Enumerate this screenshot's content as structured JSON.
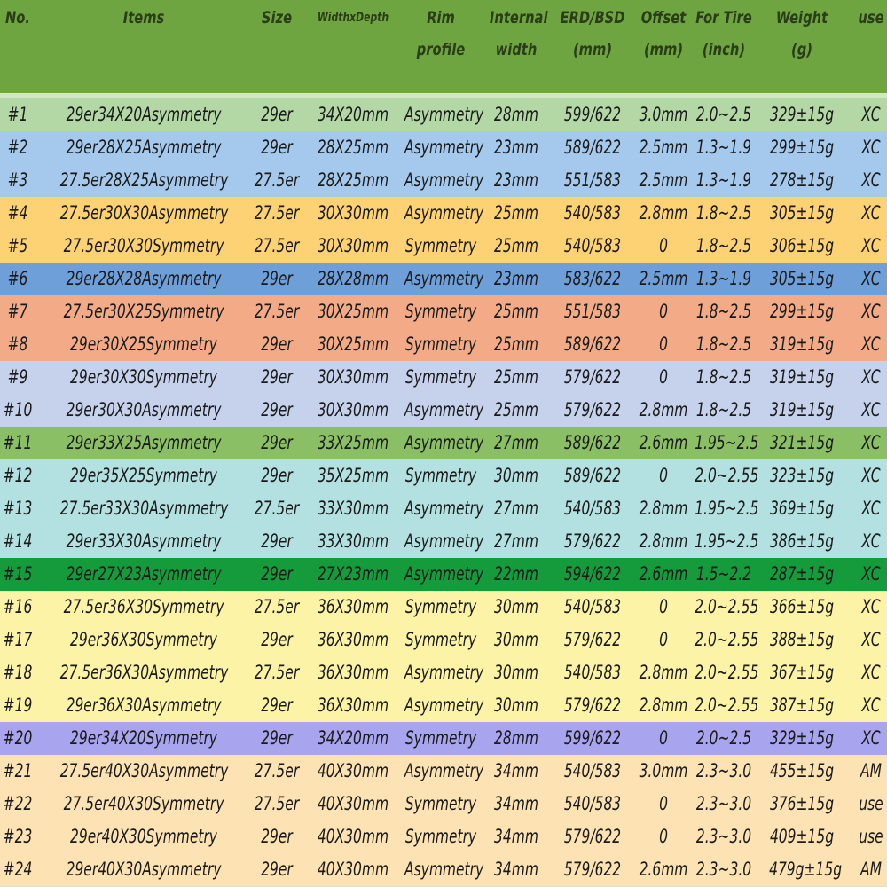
{
  "table": {
    "headers": [
      {
        "key": "no",
        "label": "No."
      },
      {
        "key": "items",
        "label": "Items"
      },
      {
        "key": "size",
        "label": "Size"
      },
      {
        "key": "wd",
        "label": "WidthxDepth"
      },
      {
        "key": "profile",
        "label": "Rim profile"
      },
      {
        "key": "internal",
        "label": "Internal\nwidth"
      },
      {
        "key": "erd",
        "label": "ERD/BSD\n(mm)"
      },
      {
        "key": "offset",
        "label": "Offset\n(mm)"
      },
      {
        "key": "tire",
        "label": "For Tire\n(inch)"
      },
      {
        "key": "weight",
        "label": "Weight\n(g)"
      },
      {
        "key": "use",
        "label": "use"
      }
    ],
    "rows": [
      {
        "cells": [
          "#1",
          "29er34X20Asymmetry",
          "29er",
          "34X20mm",
          "Asymmetry",
          "28mm",
          "599/622",
          "3.0mm",
          "2.0~2.5",
          "329±15g",
          "XC"
        ],
        "bg": "#b3d8a6"
      },
      {
        "cells": [
          "#2",
          "29er28X25Asymmetry",
          "29er",
          "28X25mm",
          "Asymmetry",
          "23mm",
          "589/622",
          "2.5mm",
          "1.3~1.9",
          "299±15g",
          "XC"
        ],
        "bg": "#a4c9ec"
      },
      {
        "cells": [
          "#3",
          "27.5er28X25Asymmetry",
          "27.5er",
          "28X25mm",
          "Asymmetry",
          "23mm",
          "551/583",
          "2.5mm",
          "1.3~1.9",
          "278±15g",
          "XC"
        ],
        "bg": "#a4c9ec"
      },
      {
        "cells": [
          "#4",
          "27.5er30X30Asymmetry",
          "27.5er",
          "30X30mm",
          "Asymmetry",
          "25mm",
          "540/583",
          "2.8mm",
          "1.8~2.5",
          "305±15g",
          "XC"
        ],
        "bg": "#fdd275"
      },
      {
        "cells": [
          "#5",
          "27.5er30X30Symmetry",
          "27.5er",
          "30X30mm",
          "Symmetry",
          "25mm",
          "540/583",
          "0",
          "1.8~2.5",
          "306±15g",
          "XC"
        ],
        "bg": "#fdd275"
      },
      {
        "cells": [
          "#6",
          "29er28X28Asymmetry",
          "29er",
          "28X28mm",
          "Asymmetry",
          "23mm",
          "583/622",
          "2.5mm",
          "1.3~1.9",
          "305±15g",
          "XC"
        ],
        "bg": "#6f9fd9"
      },
      {
        "cells": [
          "#7",
          "27.5er30X25Symmetry",
          "27.5er",
          "30X25mm",
          "Symmetry",
          "25mm",
          "551/583",
          "0",
          "1.8~2.5",
          "299±15g",
          "XC"
        ],
        "bg": "#f2ab86"
      },
      {
        "cells": [
          "#8",
          "29er30X25Symmetry",
          "29er",
          "30X25mm",
          "Symmetry",
          "25mm",
          "589/622",
          "0",
          "1.8~2.5",
          "319±15g",
          "XC"
        ],
        "bg": "#f2ab86"
      },
      {
        "cells": [
          "#9",
          "29er30X30Symmetry",
          "29er",
          "30X30mm",
          "Symmetry",
          "25mm",
          "579/622",
          "0",
          "1.8~2.5",
          "319±15g",
          "XC"
        ],
        "bg": "#c6d2ec"
      },
      {
        "cells": [
          "#10",
          "29er30X30Asymmetry",
          "29er",
          "30X30mm",
          "Asymmetry",
          "25mm",
          "579/622",
          "2.8mm",
          "1.8~2.5",
          "319±15g",
          "XC"
        ],
        "bg": "#c6d2ec"
      },
      {
        "cells": [
          "#11",
          "29er33X25Asymmetry",
          "29er",
          "33X25mm",
          "Asymmetry",
          "27mm",
          "589/622",
          "2.6mm",
          "1.95~2.5",
          "321±15g",
          "XC"
        ],
        "bg": "#8abf65"
      },
      {
        "cells": [
          "#12",
          "29er35X25Symmetry",
          "29er",
          "35X25mm",
          "Symmetry",
          "30mm",
          "589/622",
          "0",
          "2.0~2.55",
          "323±15g",
          "XC"
        ],
        "bg": "#b3e0e0"
      },
      {
        "cells": [
          "#13",
          "27.5er33X30Asymmetry",
          "27.5er",
          "33X30mm",
          "Asymmetry",
          "27mm",
          "540/583",
          "2.8mm",
          "1.95~2.5",
          "369±15g",
          "XC"
        ],
        "bg": "#b3e0e0"
      },
      {
        "cells": [
          "#14",
          "29er33X30Asymmetry",
          "29er",
          "33X30mm",
          "Asymmetry",
          "27mm",
          "579/622",
          "2.8mm",
          "1.95~2.5",
          "386±15g",
          "XC"
        ],
        "bg": "#b3e0e0"
      },
      {
        "cells": [
          "#15",
          "29er27X23Asymmetry",
          "29er",
          "27X23mm",
          "Asymmetry",
          "22mm",
          "594/622",
          "2.6mm",
          "1.5~2.2",
          "287±15g",
          "XC"
        ],
        "bg": "#159a3c"
      },
      {
        "cells": [
          "#16",
          "27.5er36X30Symmetry",
          "27.5er",
          "36X30mm",
          "Symmetry",
          "30mm",
          "540/583",
          "0",
          "2.0~2.55",
          "366±15g",
          "XC"
        ],
        "bg": "#fcf3a6"
      },
      {
        "cells": [
          "#17",
          "29er36X30Symmetry",
          "29er",
          "36X30mm",
          "Symmetry",
          "30mm",
          "579/622",
          "0",
          "2.0~2.55",
          "388±15g",
          "XC"
        ],
        "bg": "#fcf3a6"
      },
      {
        "cells": [
          "#18",
          "27.5er36X30Asymmetry",
          "27.5er",
          "36X30mm",
          "Asymmetry",
          "30mm",
          "540/583",
          "2.8mm",
          "2.0~2.55",
          "367±15g",
          "XC"
        ],
        "bg": "#fcf3a6"
      },
      {
        "cells": [
          "#19",
          "29er36X30Asymmetry",
          "29er",
          "36X30mm",
          "Asymmetry",
          "30mm",
          "579/622",
          "2.8mm",
          "2.0~2.55",
          "387±15g",
          "XC"
        ],
        "bg": "#fcf3a6"
      },
      {
        "cells": [
          "#20",
          "29er34X20Symmetry",
          "29er",
          "34X20mm",
          "Symmetry",
          "28mm",
          "599/622",
          "0",
          "2.0~2.5",
          "329±15g",
          "XC"
        ],
        "bg": "#a8a4ee"
      },
      {
        "cells": [
          "#21",
          "27.5er40X30Asymmetry",
          "27.5er",
          "40X30mm",
          "Asymmetry",
          "34mm",
          "540/583",
          "3.0mm",
          "2.3~3.0",
          "455±15g",
          "AM"
        ],
        "bg": "#fde3b3"
      },
      {
        "cells": [
          "#22",
          "27.5er40X30Symmetry",
          "27.5er",
          "40X30mm",
          "Symmetry",
          "34mm",
          "540/583",
          "0",
          "2.3~3.0",
          "376±15g",
          "use"
        ],
        "bg": "#fde3b3"
      },
      {
        "cells": [
          "#23",
          "29er40X30Symmetry",
          "29er",
          "40X30mm",
          "Symmetry",
          "34mm",
          "579/622",
          "0",
          "2.3~3.0",
          "409±15g",
          "use"
        ],
        "bg": "#fde3b3"
      },
      {
        "cells": [
          "#24",
          "29er40X30Asymmetry",
          "29er",
          "40X30mm",
          "Asymmetry",
          "34mm",
          "579/622",
          "2.6mm",
          "2.3~3.0",
          "479g±15g",
          "AM"
        ],
        "bg": "#fde3b3"
      }
    ]
  }
}
